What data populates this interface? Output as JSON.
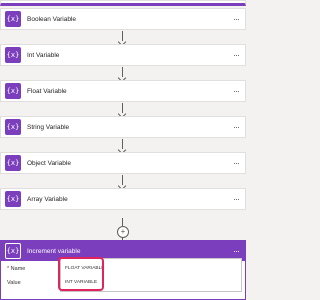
{
  "steps": [
    {
      "icon": "{x}",
      "title": "Boolean Variable",
      "more": "···"
    },
    {
      "icon": "{x}",
      "title": "Int Variable",
      "more": "···"
    },
    {
      "icon": "{x}",
      "title": "Float Variable",
      "more": "···"
    },
    {
      "icon": "{x}",
      "title": "String Variable",
      "more": "···"
    },
    {
      "icon": "{x}",
      "title": "Object Variable",
      "more": "···"
    },
    {
      "icon": "{x}",
      "title": "Array Variable",
      "more": "···"
    }
  ],
  "increment": {
    "icon": "{x}",
    "title": "Increment variable",
    "more": "···",
    "name_label": "Name",
    "required_mark": "*",
    "value_label": "Value",
    "plus": "+",
    "options": [
      "FLOAT VARIABLE",
      "INT VARIABLE"
    ]
  },
  "colors": {
    "accent": "#7b3fbe",
    "highlight": "#e0245e",
    "background": "#f3f2f1"
  },
  "icons": {
    "variable": "variable-icon",
    "more": "more-icon",
    "chevron": "chevron-down-icon",
    "arrow": "arrow-down-icon"
  }
}
